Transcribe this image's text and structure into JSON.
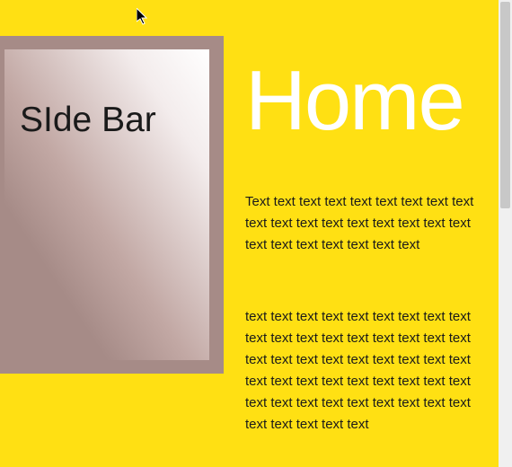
{
  "sidebar": {
    "title": "SIde Bar"
  },
  "main": {
    "heading": "Home",
    "paragraph1": "Text text text text text text text text text text text text text text text text text text text text text text text text text",
    "paragraph2": "text text text text text text text text text text text text text text text text text text text text text text text text text text text text text text text text text text text text text text text text text text text text text text text text text text"
  },
  "colors": {
    "background": "#ffe013",
    "sidebar_bg": "#a68b87",
    "heading_color": "#ffffff",
    "text_color": "#1a1a1a"
  }
}
